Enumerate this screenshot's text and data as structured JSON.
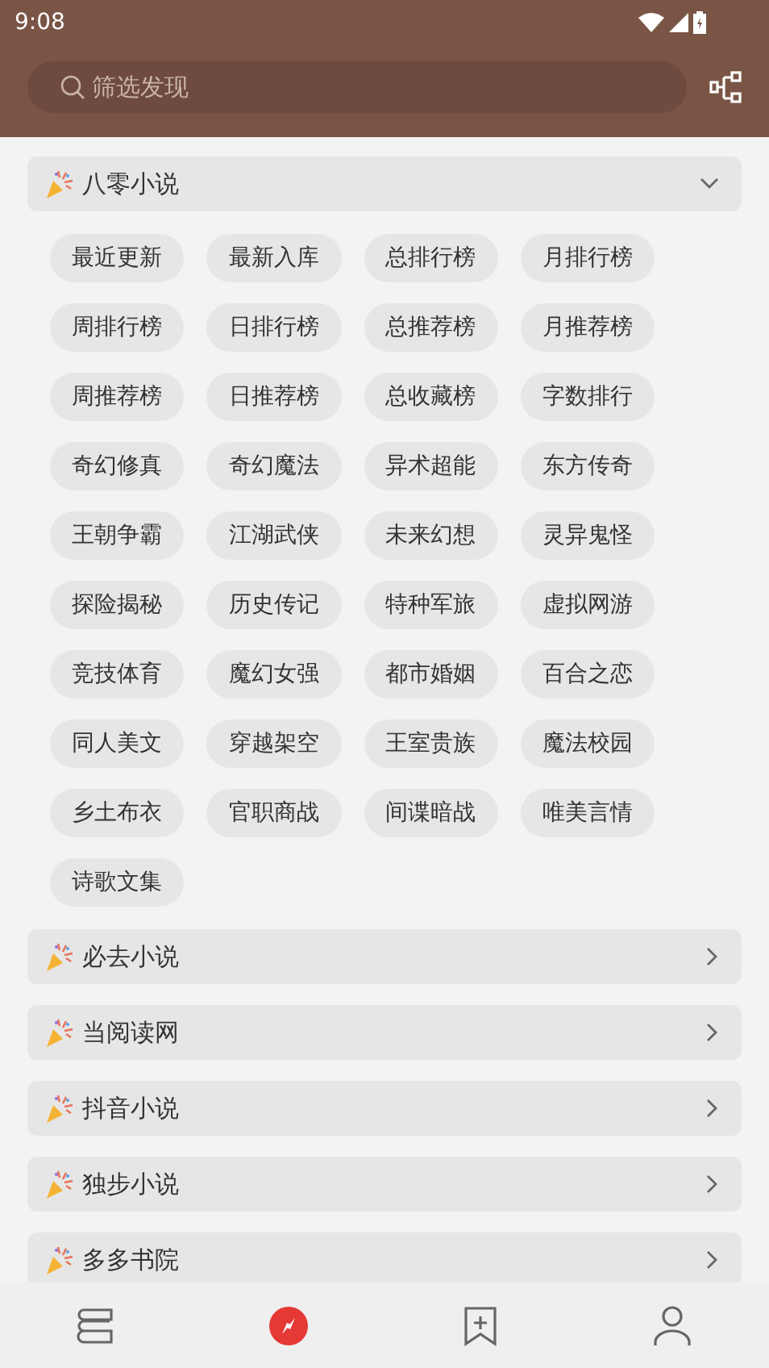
{
  "status_bar": {
    "time": "9:08"
  },
  "search": {
    "placeholder": "筛选发现"
  },
  "sections": [
    {
      "title": "八零小说",
      "expanded": true,
      "tags": [
        "最近更新",
        "最新入库",
        "总排行榜",
        "月排行榜",
        "周排行榜",
        "日排行榜",
        "总推荐榜",
        "月推荐榜",
        "周推荐榜",
        "日推荐榜",
        "总收藏榜",
        "字数排行",
        "奇幻修真",
        "奇幻魔法",
        "异术超能",
        "东方传奇",
        "王朝争霸",
        "江湖武侠",
        "未来幻想",
        "灵异鬼怪",
        "探险揭秘",
        "历史传记",
        "特种军旅",
        "虚拟网游",
        "竞技体育",
        "魔幻女强",
        "都市婚姻",
        "百合之恋",
        "同人美文",
        "穿越架空",
        "王室贵族",
        "魔法校园",
        "乡土布衣",
        "官职商战",
        "间谍暗战",
        "唯美言情",
        "诗歌文集"
      ]
    },
    {
      "title": "必去小说",
      "expanded": false
    },
    {
      "title": "当阅读网",
      "expanded": false
    },
    {
      "title": "抖音小说",
      "expanded": false
    },
    {
      "title": "独步小说",
      "expanded": false
    },
    {
      "title": "多多书院",
      "expanded": false
    }
  ],
  "bottom_nav": [
    {
      "selected": false
    },
    {
      "selected": true
    },
    {
      "selected": false
    },
    {
      "selected": false
    }
  ]
}
